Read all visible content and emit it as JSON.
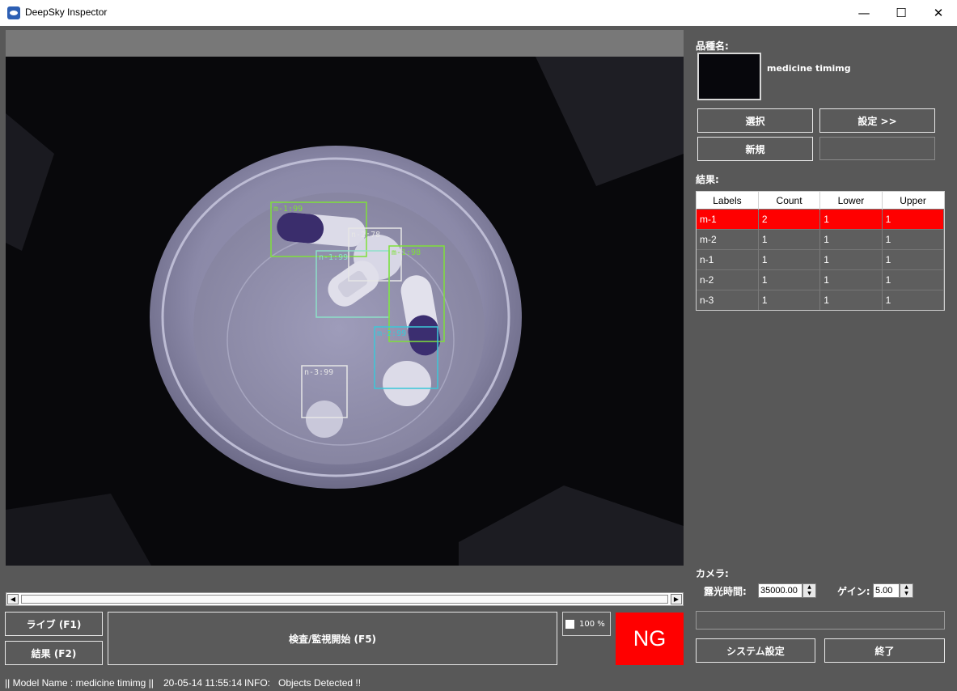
{
  "window": {
    "title": "DeepSky Inspector",
    "minimize": "—",
    "maximize": "☐",
    "close": "✕"
  },
  "viewer": {
    "detections": [
      {
        "label": "m-1:99",
        "color": "#7fe03a"
      },
      {
        "label": "n-2:78",
        "color": "#e6e6e6"
      },
      {
        "label": "n-1:99",
        "color": "#8de0c8"
      },
      {
        "label": "m-1:98",
        "color": "#7fe03a"
      },
      {
        "label": "m-2:99",
        "color": "#3ac8d8"
      },
      {
        "label": "n-3:99",
        "color": "#e6e6e6"
      }
    ],
    "zoom_label": "100 %",
    "scroll_left": "◀",
    "scroll_right": "▶"
  },
  "product": {
    "heading": "品種名:",
    "name": "medicine timimg"
  },
  "buttons": {
    "select": "選択",
    "settings": "設定 >>",
    "new": "新規",
    "live": "ライブ (F1)",
    "result": "結果 (F2)",
    "inspect": "検査/監視開始 (F5)",
    "system_settings": "システム設定",
    "exit": "終了"
  },
  "results": {
    "heading": "結果:",
    "columns": [
      "Labels",
      "Count",
      "Lower",
      "Upper"
    ],
    "rows": [
      {
        "label": "m-1",
        "count": "2",
        "lower": "1",
        "upper": "1",
        "status": "ng"
      },
      {
        "label": "m-2",
        "count": "1",
        "lower": "1",
        "upper": "1",
        "status": "ok"
      },
      {
        "label": "n-1",
        "count": "1",
        "lower": "1",
        "upper": "1",
        "status": "ok"
      },
      {
        "label": "n-2",
        "count": "1",
        "lower": "1",
        "upper": "1",
        "status": "ok"
      },
      {
        "label": "n-3",
        "count": "1",
        "lower": "1",
        "upper": "1",
        "status": "ok"
      }
    ]
  },
  "camera": {
    "heading": "カメラ:",
    "exposure_label": "露光時間:",
    "exposure_value": "35000.00",
    "gain_label": "ゲイン:",
    "gain_value": "5.00"
  },
  "verdict": {
    "text": "NG",
    "color": "#ff0000"
  },
  "statusbar": {
    "model": "|| Model Name : medicine timimg ||",
    "timestamp": "20-05-14 11:55:14",
    "info": "INFO:   Objects Detected !!"
  }
}
